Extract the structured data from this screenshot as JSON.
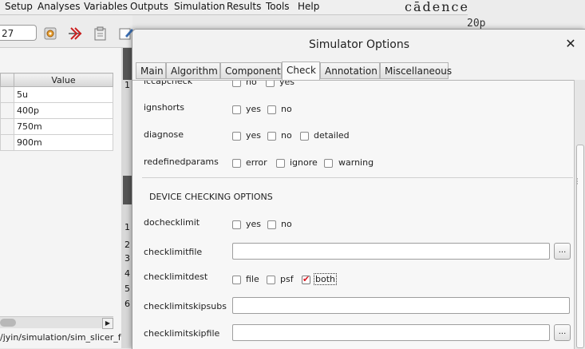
{
  "main_window": {
    "menus": [
      "Setup",
      "Analyses",
      "Variables",
      "Outputs",
      "Simulation",
      "Results",
      "Tools",
      "Help"
    ],
    "logo": "cādence",
    "bg_value": "20p",
    "temperature": "27",
    "variables_table": {
      "header": "Value",
      "rows": [
        "5u",
        "400p",
        "750m",
        "900m"
      ]
    },
    "strip_rows": [
      "1",
      "1",
      "2",
      "3",
      "4",
      "5",
      "6"
    ],
    "status_path": "/jyin/simulation/sim_slicer_fu"
  },
  "dialog": {
    "title": "Simulator Options",
    "close_icon": "close-icon",
    "tabs": [
      "Main",
      "Algorithm",
      "Component",
      "Check",
      "Annotation",
      "Miscellaneous"
    ],
    "active_tab": "Check",
    "options": {
      "iccapcheck": {
        "label": "iccapcheck",
        "choices": [
          "no",
          "yes"
        ]
      },
      "ignshorts": {
        "label": "ignshorts",
        "choices": [
          "yes",
          "no"
        ]
      },
      "diagnose": {
        "label": "diagnose",
        "choices": [
          "yes",
          "no",
          "detailed"
        ]
      },
      "redefinedparams": {
        "label": "redefinedparams",
        "choices": [
          "error",
          "ignore",
          "warning"
        ]
      }
    },
    "section_device_checking": "DEVICE CHECKING OPTIONS",
    "device_options": {
      "dochecklimit": {
        "label": "dochecklimit",
        "choices": [
          "yes",
          "no"
        ]
      },
      "checklimitfile": {
        "label": "checklimitfile",
        "value": "",
        "browse": "..."
      },
      "checklimitdest": {
        "label": "checklimitdest",
        "choices": [
          "file",
          "psf",
          "both"
        ],
        "checked": "both"
      },
      "checklimitskipsubs": {
        "label": "checklimitskipsubs",
        "value": ""
      },
      "checklimitskipfile": {
        "label": "checklimitskipfile",
        "value": "",
        "browse": "..."
      }
    },
    "check_color": "#d8151f"
  }
}
